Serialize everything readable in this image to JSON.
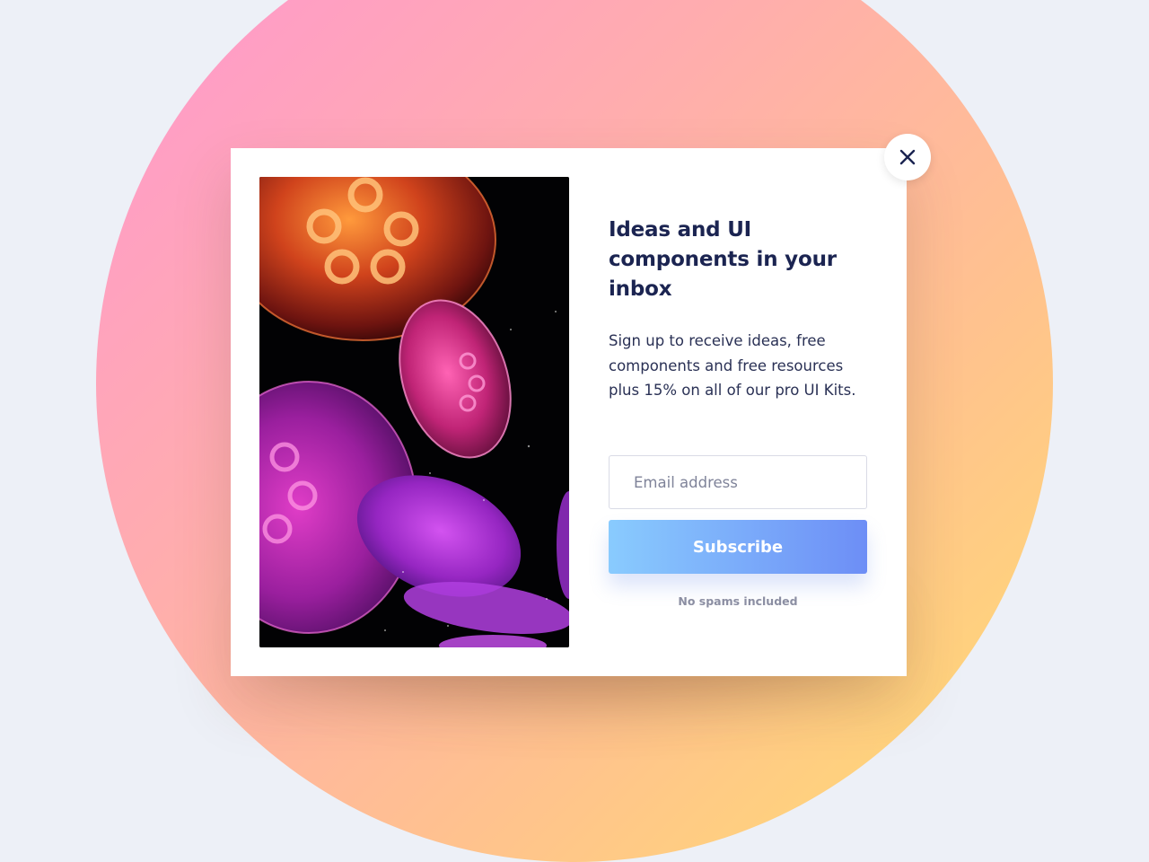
{
  "popup": {
    "title": "Ideas and UI components in your inbox",
    "description": "Sign up to receive ideas, free components and free resources plus 15% on all of our pro UI Kits.",
    "email_placeholder": "Email address",
    "email_value": "",
    "subscribe_label": "Subscribe",
    "footnote": "No spams included",
    "close_icon": "close-icon",
    "image_subject": "jellyfish-photo"
  },
  "colors": {
    "page_background": "#edf0f7",
    "circle_gradient": [
      "#ff95d2",
      "#ffadae",
      "#ffc28e",
      "#ffde70"
    ],
    "title_text": "#1b2451",
    "button_gradient": [
      "#89cbfe",
      "#6d8ef6"
    ],
    "footnote_text": "#8b8ea2"
  }
}
